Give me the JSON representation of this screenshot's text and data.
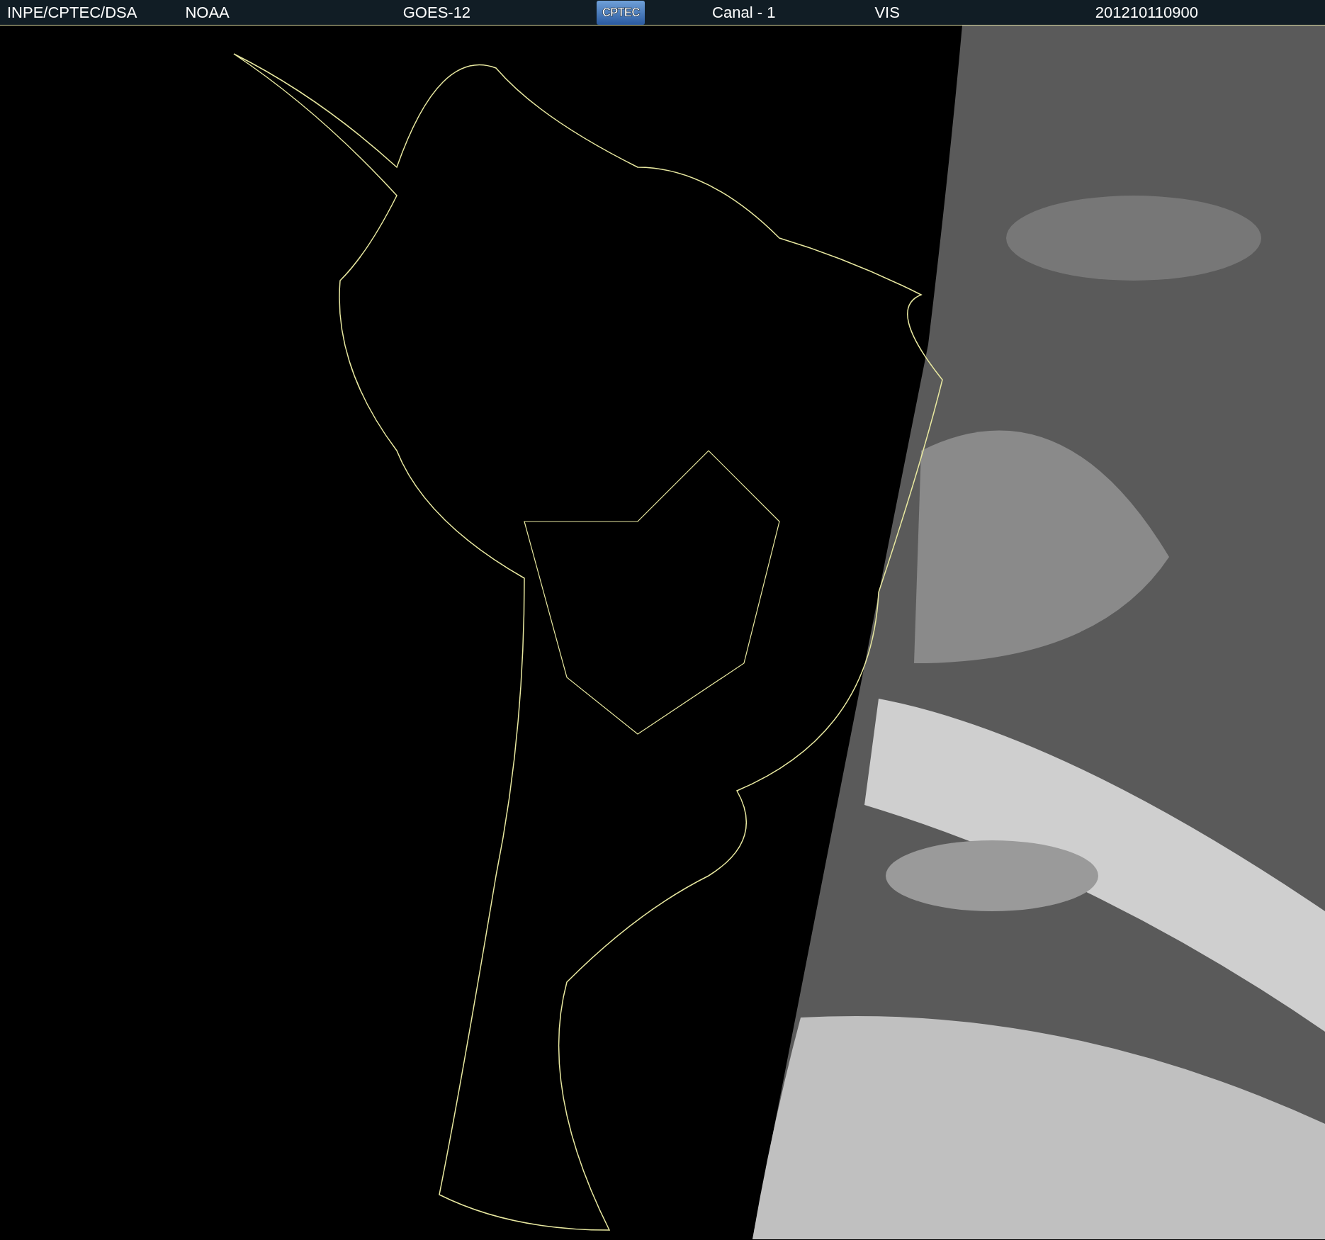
{
  "header": {
    "source": "INPE/CPTEC/DSA",
    "agency": "NOAA",
    "satellite": "GOES-12",
    "logo_text": "CPTEC",
    "channel": "Canal - 1",
    "band": "VIS",
    "timestamp": "201210110900"
  }
}
